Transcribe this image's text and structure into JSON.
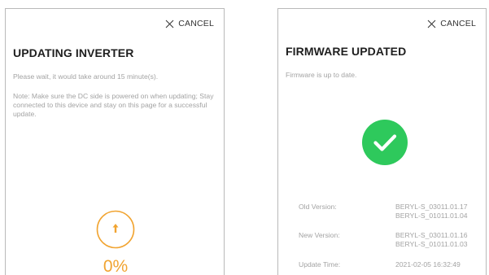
{
  "colors": {
    "progress_accent": "#f1a431",
    "success_green": "#2ec95c",
    "text_muted": "#a3a3a3",
    "title": "#1f1f1f"
  },
  "updating_screen": {
    "cancel_label": "CANCEL",
    "title": "UPDATING INVERTER",
    "wait_message": "Please wait,  it would take around  15  minute(s).",
    "note_message": "Note: Make sure the DC side is powered on when updating; Stay connected to this device and stay on this page for a successful update.",
    "progress_icon": "arrow-up-icon",
    "progress_percent": 0,
    "progress_label": "0%"
  },
  "updated_screen": {
    "cancel_label": "CANCEL",
    "title": "FIRMWARE UPDATED",
    "status_message": "Firmware is up to date.",
    "status_icon": "checkmark-icon",
    "details": [
      {
        "label": "Old Version:",
        "values": [
          "BERYL-S_03011.01.17",
          "BERYL-S_01011.01.04"
        ]
      },
      {
        "label": "New Version:",
        "values": [
          "BERYL-S_03011.01.16",
          "BERYL-S_01011.01.03"
        ]
      },
      {
        "label": "Update Time:",
        "values": [
          "2021-02-05 16:32:49"
        ]
      }
    ]
  }
}
